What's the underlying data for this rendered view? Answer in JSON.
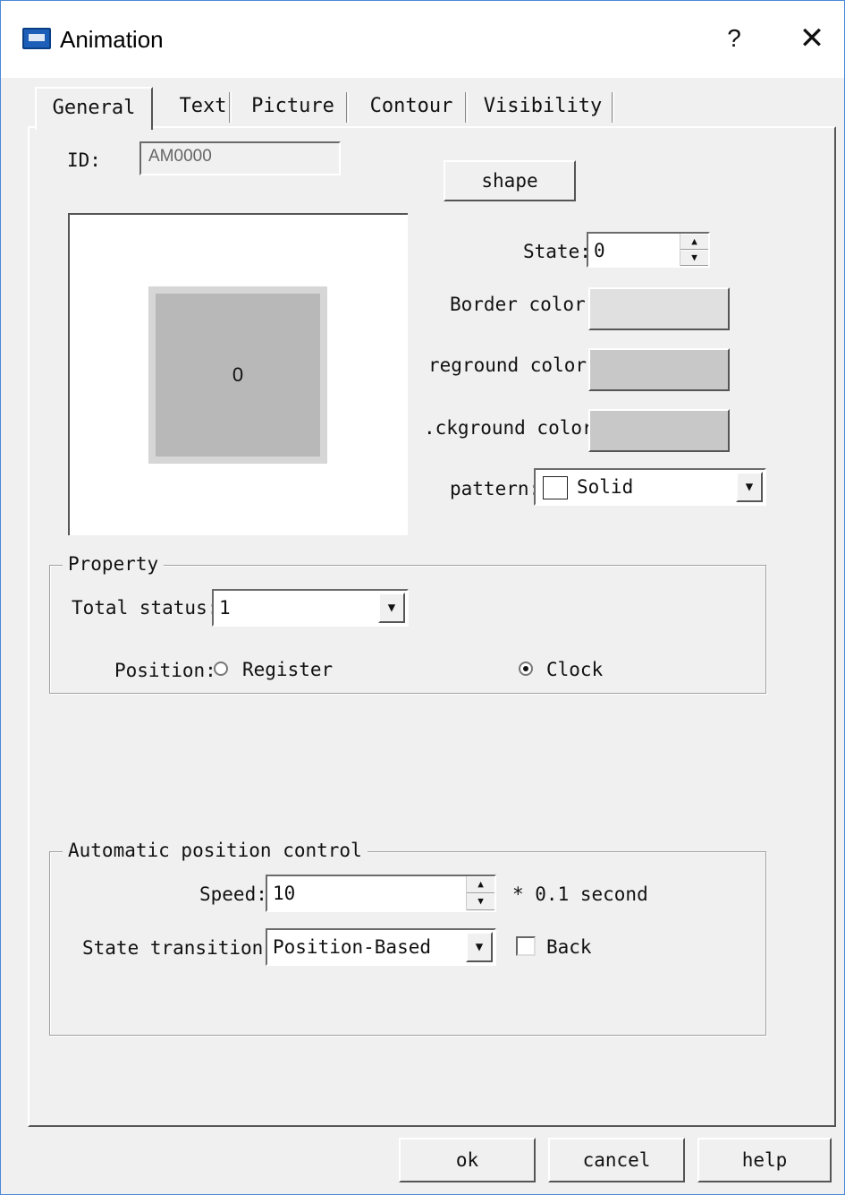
{
  "window": {
    "title": "Animation",
    "help_label": "?",
    "close_label": "✕"
  },
  "tabs": [
    "General",
    "Text",
    "Picture",
    "Contour",
    "Visibility"
  ],
  "general": {
    "id_label": "ID:",
    "id_value": "AM0000",
    "shape_button": "shape",
    "preview_text": "0",
    "state_label": "State:",
    "state_value": "0",
    "border_color_label": "Border color:",
    "foreground_color_label": "reground color:",
    "background_color_label": ".ckground color:",
    "pattern_label": "pattern:",
    "pattern_value": "Solid"
  },
  "colors": {
    "border": "#e0e0e0",
    "foreground": "#c8c8c8",
    "background": "#c8c8c8"
  },
  "property": {
    "title": "Property",
    "total_status_label": "Total status:",
    "total_status_value": "1",
    "position_label": "Position:",
    "option_register": "Register",
    "option_clock": "Clock",
    "selected": "Clock"
  },
  "auto": {
    "title": "Automatic position control",
    "speed_label": "Speed:",
    "speed_value": "10",
    "speed_unit": "* 0.1 second",
    "transition_label": "State transition:",
    "transition_value": "Position-Based",
    "back_label": "Back",
    "back_checked": false
  },
  "footer": {
    "ok": "ok",
    "cancel": "cancel",
    "help": "help"
  }
}
